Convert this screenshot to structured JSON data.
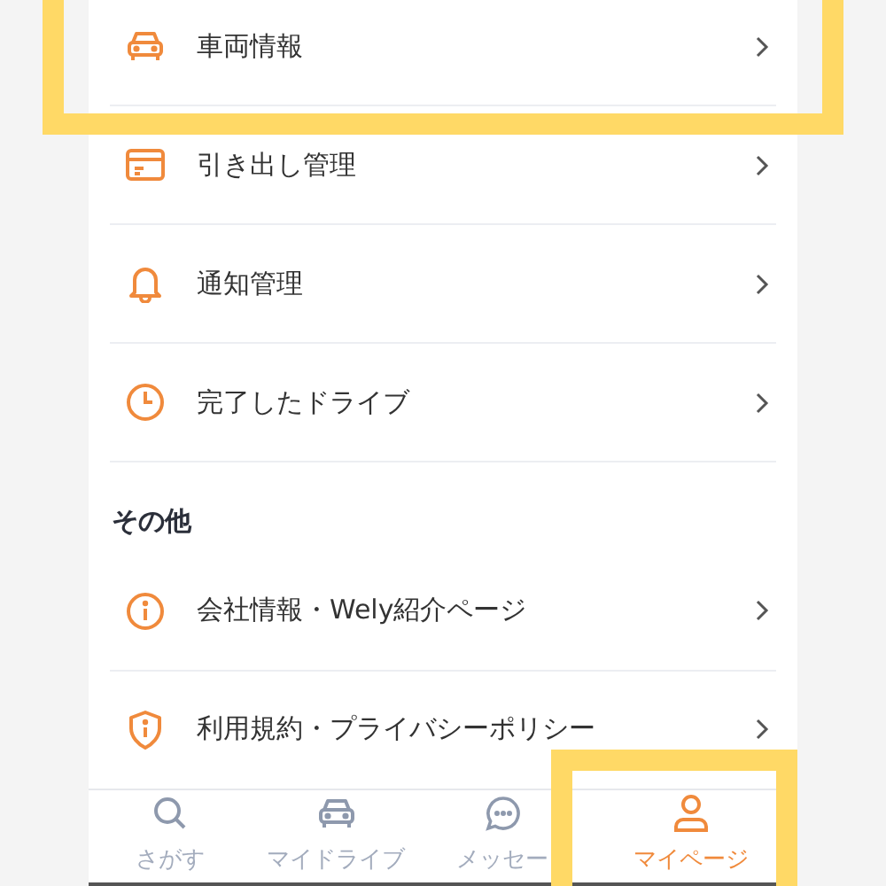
{
  "menu_sections": [
    {
      "items": [
        {
          "label": "車両情報"
        },
        {
          "label": "引き出し管理"
        },
        {
          "label": "通知管理"
        },
        {
          "label": "完了したドライブ"
        }
      ]
    },
    {
      "title": "その他",
      "items": [
        {
          "label": "会社情報・Wely紹介ページ"
        },
        {
          "label": "利用規約・プライバシーポリシー"
        }
      ]
    }
  ],
  "tab_bar": [
    {
      "label": "さがす",
      "selected": false
    },
    {
      "label": "マイドライブ",
      "selected": false
    },
    {
      "label": "メッセー",
      "selected": false
    },
    {
      "label": "マイページ",
      "selected": true
    }
  ]
}
